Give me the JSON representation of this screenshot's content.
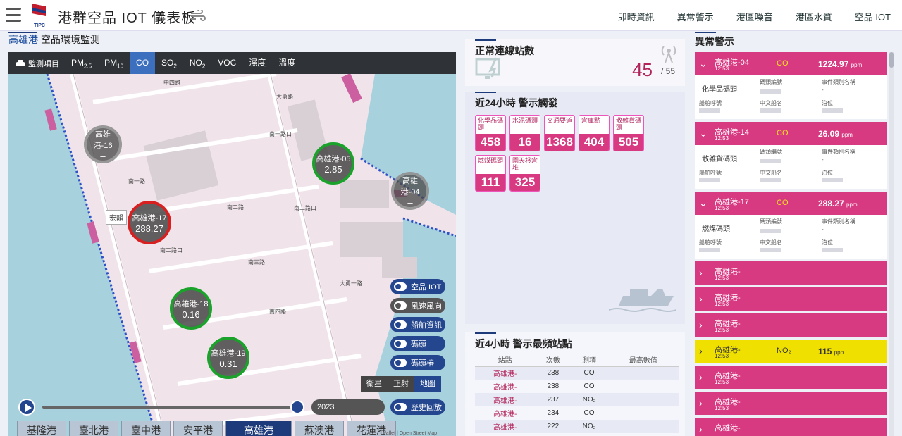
{
  "header": {
    "logo_text": "TIPC",
    "title": "港群空品 IOT 儀表板",
    "nav": [
      "即時資訊",
      "異常警示",
      "港區噪音",
      "港區水質",
      "空品 IOT"
    ]
  },
  "left": {
    "port_name": "高雄港",
    "title": "空品環境監測",
    "toolbar_label": "監測項目",
    "pollutant_tabs": [
      {
        "main": "PM",
        "sub": "2.5"
      },
      {
        "main": "PM",
        "sub": "10"
      },
      {
        "main": "CO",
        "sub": ""
      },
      {
        "main": "SO",
        "sub": "2"
      },
      {
        "main": "NO",
        "sub": "2"
      },
      {
        "main": "VOC",
        "sub": ""
      },
      {
        "main": "濕度",
        "sub": ""
      },
      {
        "main": "溫度",
        "sub": ""
      }
    ],
    "stations": [
      {
        "name": "高雄港-16",
        "value": "–",
        "status": "grey"
      },
      {
        "name": "高雄港-05",
        "value": "2.85",
        "status": "green"
      },
      {
        "name": "高雄港-04",
        "value": "–",
        "status": "grey"
      },
      {
        "name": "高雄港-17",
        "value": "288.27",
        "status": "red"
      },
      {
        "name": "高雄港-18",
        "value": "0.16",
        "status": "green"
      },
      {
        "name": "高雄港-19",
        "value": "0.31",
        "status": "green"
      }
    ],
    "tooltip": "宏韻",
    "layer_toggles": [
      "空品 IOT",
      "風速風向",
      "船舶資訊",
      "碼頭",
      "碼頭樁"
    ],
    "basemaps": [
      "衛星",
      "正射",
      "地圖"
    ],
    "history_toggle": "歷史回放",
    "time_label": "2023",
    "port_tabs": [
      "基隆港",
      "臺北港",
      "臺中港",
      "安平港",
      "高雄港",
      "蘇澳港",
      "花蓮港"
    ],
    "attribution": "Leaflet | Open Street Map",
    "map_labels": {
      "road_zhongsi": "中四路",
      "road_dayong": "大勇路",
      "road_nan1": "南一路",
      "road_nan1_station": "南一路口",
      "road_nan2": "南二路",
      "road_nan2_station": "南二路口",
      "road_nan3": "南三路",
      "road_nan4": "南四路",
      "road_dayong2": "大勇一路"
    }
  },
  "middle": {
    "online": {
      "title": "正常連線站數",
      "count": "45",
      "total": "/ 55"
    },
    "alerts24": {
      "title": "近24小時 警示觸發",
      "tiles": [
        {
          "label": "化學品碼頭",
          "count": "458"
        },
        {
          "label": "水泥碼頭",
          "count": "16"
        },
        {
          "label": "交通要道",
          "count": "1368"
        },
        {
          "label": "倉庫點",
          "count": "404"
        },
        {
          "label": "散雜貨碼頭",
          "count": "505"
        },
        {
          "label": "燃煤碼頭",
          "count": "111"
        },
        {
          "label": "園天棧倉堆",
          "count": "325"
        }
      ]
    },
    "freq": {
      "title": "近4小時 警示最頻站點",
      "headers": [
        "站點",
        "次數",
        "測項",
        "最高數值"
      ],
      "rows": [
        {
          "station": "高雄港-",
          "count": "238",
          "item": "CO"
        },
        {
          "station": "高雄港-",
          "count": "238",
          "item": "CO"
        },
        {
          "station": "高雄港-",
          "count": "237",
          "item": "NO₂"
        },
        {
          "station": "高雄港-",
          "count": "234",
          "item": "CO"
        },
        {
          "station": "高雄港-",
          "count": "222",
          "item": "NO₂"
        }
      ]
    }
  },
  "right": {
    "title": "異常警示",
    "alerts": [
      {
        "name": "高雄港-04",
        "time": "12:53",
        "pollutant": "CO",
        "value": "1224.97",
        "unit": "ppm",
        "expanded": true,
        "location": "化學品碼頭",
        "color": "pink"
      },
      {
        "name": "高雄港-14",
        "time": "12:53",
        "pollutant": "CO",
        "value": "26.09",
        "unit": "ppm",
        "expanded": true,
        "location": "散雜貨碼頭",
        "color": "pink"
      },
      {
        "name": "高雄港-17",
        "time": "12:53",
        "pollutant": "CO",
        "value": "288.27",
        "unit": "ppm",
        "expanded": true,
        "location": "燃煤碼頭",
        "color": "pink"
      },
      {
        "name": "高雄港-",
        "time": "12:53",
        "pollutant": "",
        "value": "",
        "unit": "",
        "expanded": false,
        "color": "pink"
      },
      {
        "name": "高雄港-",
        "time": "12:53",
        "pollutant": "",
        "value": "",
        "unit": "",
        "expanded": false,
        "color": "pink"
      },
      {
        "name": "高雄港-",
        "time": "12:53",
        "pollutant": "",
        "value": "",
        "unit": "",
        "expanded": false,
        "color": "pink"
      },
      {
        "name": "高雄港-",
        "time": "12:53",
        "pollutant": "NO₂",
        "value": "115",
        "unit": "ppb",
        "expanded": false,
        "color": "yellow"
      },
      {
        "name": "高雄港-",
        "time": "12:53",
        "pollutant": "",
        "value": "",
        "unit": "",
        "expanded": false,
        "color": "pink"
      },
      {
        "name": "高雄港-",
        "time": "12:53",
        "pollutant": "",
        "value": "",
        "unit": "",
        "expanded": false,
        "color": "pink"
      },
      {
        "name": "高雄港-",
        "time": "",
        "pollutant": "",
        "value": "",
        "unit": "",
        "expanded": false,
        "color": "pink"
      }
    ],
    "detail_labels": {
      "reg": "碼頭編號",
      "event": "事件類別名稱",
      "call": "船舶呼號",
      "cname": "中文船名",
      "berth": "泊位"
    },
    "detail_value_dash": "-"
  },
  "colors": {
    "primary": "#23468f",
    "alert_pink": "#d83a82",
    "alert_yellow": "#f0e000",
    "good": "#1aa22b",
    "bad": "#d82020"
  }
}
